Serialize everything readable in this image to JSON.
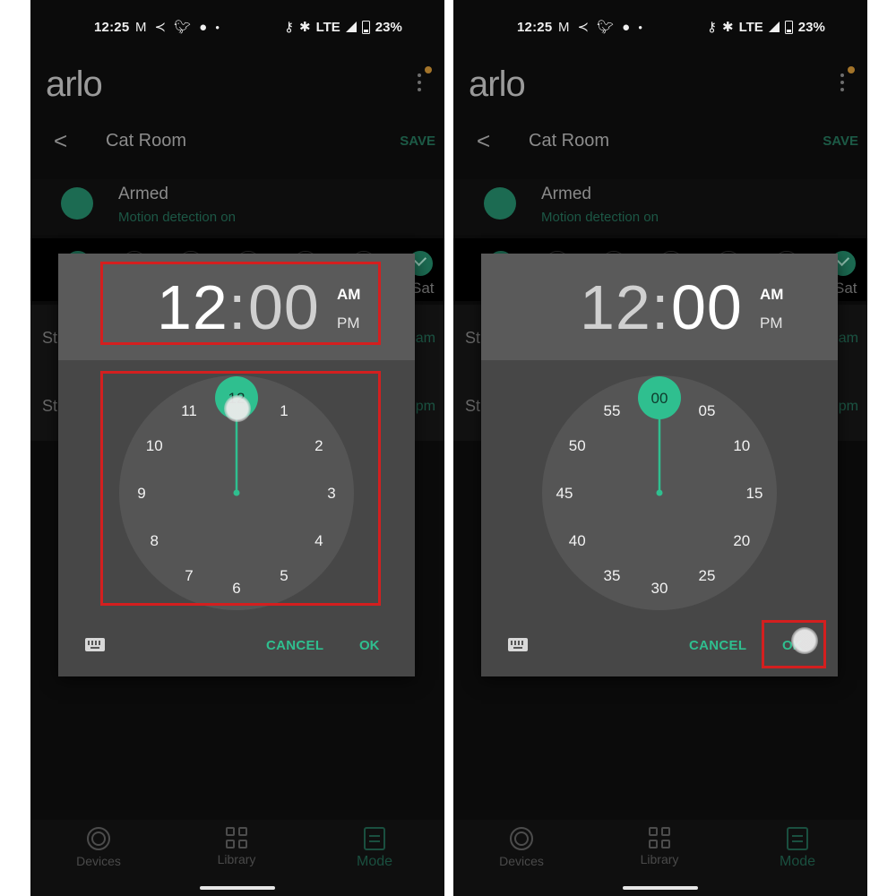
{
  "status_bar": {
    "time": "12:25",
    "left_icons": [
      "gmail-icon",
      "app-icon",
      "twitter-icon",
      "reddit-icon",
      "more-dot-icon"
    ],
    "right_icons": [
      "vpn-key-icon",
      "bluetooth-icon",
      "lte-label",
      "signal-icon",
      "battery-icon"
    ],
    "network": "LTE",
    "battery": "23%"
  },
  "app": {
    "logo": "arlo",
    "header_title": "Cat Room",
    "save_label": "SAVE",
    "back_glyph": "<",
    "mode": {
      "title": "Armed",
      "subtitle": "Motion detection on"
    },
    "days": {
      "visible_label": "Sat",
      "last_checked": true
    },
    "schedule_rows": [
      {
        "left_partial": "St",
        "right_partial": "am"
      },
      {
        "left_partial": "St",
        "right_partial": "pm"
      }
    ],
    "bottom_nav": [
      {
        "label": "Devices",
        "icon": "devices-icon",
        "active": false
      },
      {
        "label": "Library",
        "icon": "library-icon",
        "active": false
      },
      {
        "label": "Mode",
        "icon": "mode-icon",
        "active": true
      }
    ]
  },
  "panels": [
    {
      "id": "left",
      "picker_mode": "hours",
      "time": {
        "hours": "12",
        "separator": ":",
        "minutes": "00",
        "am": "AM",
        "pm": "PM",
        "period_selected": "AM"
      },
      "dial_labels": [
        "12",
        "1",
        "2",
        "3",
        "4",
        "5",
        "6",
        "7",
        "8",
        "9",
        "10",
        "11"
      ],
      "selected_index": 0,
      "cancel_label": "CANCEL",
      "ok_label": "OK",
      "annotations": [
        "time-display-highlight",
        "clock-dial-highlight"
      ],
      "touch_indicator": "on-dial-selector"
    },
    {
      "id": "right",
      "picker_mode": "minutes",
      "time": {
        "hours": "12",
        "separator": ":",
        "minutes": "00",
        "am": "AM",
        "pm": "PM",
        "period_selected": "AM"
      },
      "dial_labels": [
        "00",
        "05",
        "10",
        "15",
        "20",
        "25",
        "30",
        "35",
        "40",
        "45",
        "50",
        "55"
      ],
      "selected_index": 0,
      "cancel_label": "CANCEL",
      "ok_label": "OK",
      "annotations": [
        "ok-button-highlight"
      ],
      "touch_indicator": "on-ok-button"
    }
  ],
  "colors": {
    "accent": "#2fbf8f",
    "accent_dim": "#1c6b52",
    "highlight": "#d41f1f",
    "dialog_header": "#5a5a5a",
    "dialog_body": "#474747",
    "dial_face": "#555555",
    "notification_dot": "#a3742a"
  }
}
